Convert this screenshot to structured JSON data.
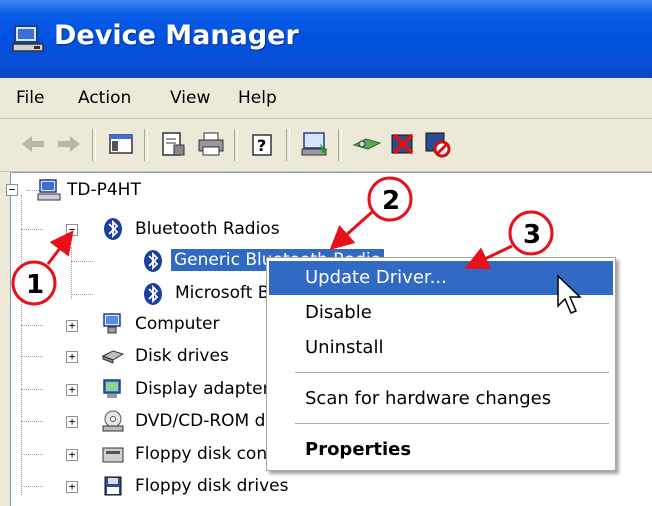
{
  "window": {
    "title": "Device Manager"
  },
  "menu": [
    "File",
    "Action",
    "View",
    "Help"
  ],
  "toolbar": {
    "icons": [
      "back-icon",
      "forward-icon",
      "show-hide-tree-icon",
      "properties-icon",
      "print-icon",
      "help-icon",
      "update-driver-icon",
      "scan-hardware-icon",
      "uninstall-icon",
      "disable-icon"
    ]
  },
  "tree": {
    "root": "TD-P4HT",
    "bluetooth": "Bluetooth Radios",
    "bt_children": [
      "Generic Bluetooth Radio",
      "Microsoft Bluetooth Enumerator"
    ],
    "categories": [
      "Computer",
      "Disk drives",
      "Display adapters",
      "DVD/CD-ROM drives",
      "Floppy disk controllers",
      "Floppy disk drives"
    ]
  },
  "context_menu": {
    "items": [
      "Update Driver...",
      "Disable",
      "Uninstall",
      "Scan for hardware changes",
      "Properties"
    ]
  },
  "callouts": [
    "1",
    "2",
    "3"
  ],
  "colors": {
    "title_bar": "#0052e0",
    "selection": "#316ac5",
    "callout_arrow": "#e8101a"
  }
}
